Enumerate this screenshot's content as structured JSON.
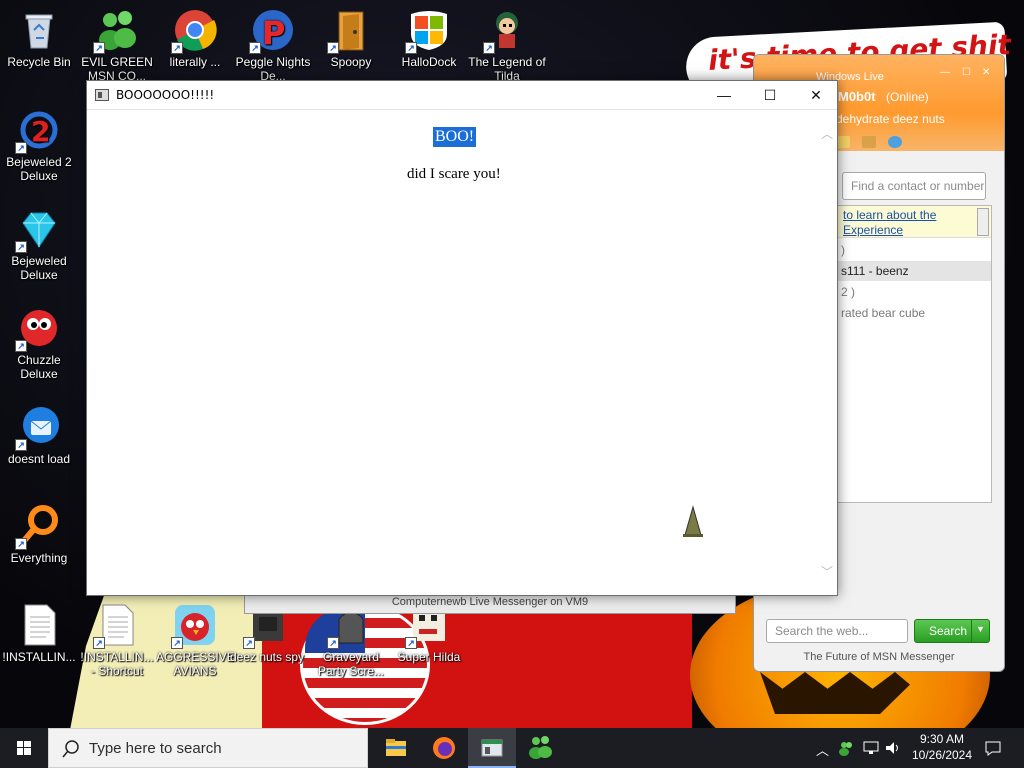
{
  "wallpaper": {
    "banner_text": "it's time to get shit"
  },
  "desktop_icons": [
    {
      "label": "Recycle Bin",
      "icon": "recycle-bin-icon"
    },
    {
      "label": "EVIL GREEN MSN CO...",
      "icon": "msn-people-icon"
    },
    {
      "label": "literally ...",
      "icon": "chrome-icon"
    },
    {
      "label": "Peggle Nights De...",
      "icon": "peggle-icon"
    },
    {
      "label": "Spoopy",
      "icon": "door-icon"
    },
    {
      "label": "HalloDock",
      "icon": "windows-flag-icon"
    },
    {
      "label": "The Legend of Tilda",
      "icon": "game-character-icon"
    },
    {
      "label": "Bejeweled 2 Deluxe",
      "icon": "bejeweled2-icon"
    },
    {
      "label": "Bejeweled Deluxe",
      "icon": "gem-icon"
    },
    {
      "label": "Chuzzle Deluxe",
      "icon": "chuzzle-icon"
    },
    {
      "label": "doesnt load",
      "icon": "thunderbird-icon"
    },
    {
      "label": "Everything",
      "icon": "magnifier-icon"
    },
    {
      "label": "!INSTALLIN...",
      "icon": "text-file-icon"
    },
    {
      "label": "!INSTALLIN... - Shortcut",
      "icon": "text-file-icon"
    },
    {
      "label": "AGGRESSIVE AVIANS",
      "icon": "angry-bird-icon"
    },
    {
      "label": "deez nuts spy",
      "icon": "spy-icon"
    },
    {
      "label": "Graveyard Party Scre...",
      "icon": "vote-icon"
    },
    {
      "label": "Super Hilda",
      "icon": "pixel-game-icon"
    }
  ],
  "popup": {
    "title": "BOOOOOOO!!!!!",
    "heading": "BOO!",
    "body_text": "did I scare you!",
    "controls": {
      "minimize": "—",
      "maximize": "☐",
      "close": "✕"
    }
  },
  "msn": {
    "window_title": "Windows Live",
    "username": "M0b0t",
    "status": "(Online)",
    "personal_message": "dehydrate deez nuts",
    "find_placeholder": "Find a contact or number",
    "notice_line1": "to learn about the",
    "notice_line2": "Experience",
    "contacts": [
      {
        "text": ")",
        "style": "gray"
      },
      {
        "text": "s111 - beenz",
        "style": "sel"
      },
      {
        "text": "2 )",
        "style": "gray"
      },
      {
        "text": "rated bear cube",
        "style": "gray"
      }
    ],
    "search_placeholder": "Search the web...",
    "search_button": "Search",
    "footer": "The Future of MSN Messenger"
  },
  "conversation_window": {
    "title": "Computernewb Live Messenger on VM9"
  },
  "taskbar": {
    "search_placeholder": "Type here to search",
    "time": "9:30 AM",
    "date": "10/26/2024",
    "apps": [
      "file-explorer-icon",
      "firefox-icon",
      "popup-window-icon",
      "msn-people-icon"
    ]
  },
  "colors": {
    "selection_blue": "#1b6ed6",
    "msn_orange": "#ff9a2e",
    "msn_green": "#2a9d24",
    "taskbar": "#1c1d22"
  }
}
